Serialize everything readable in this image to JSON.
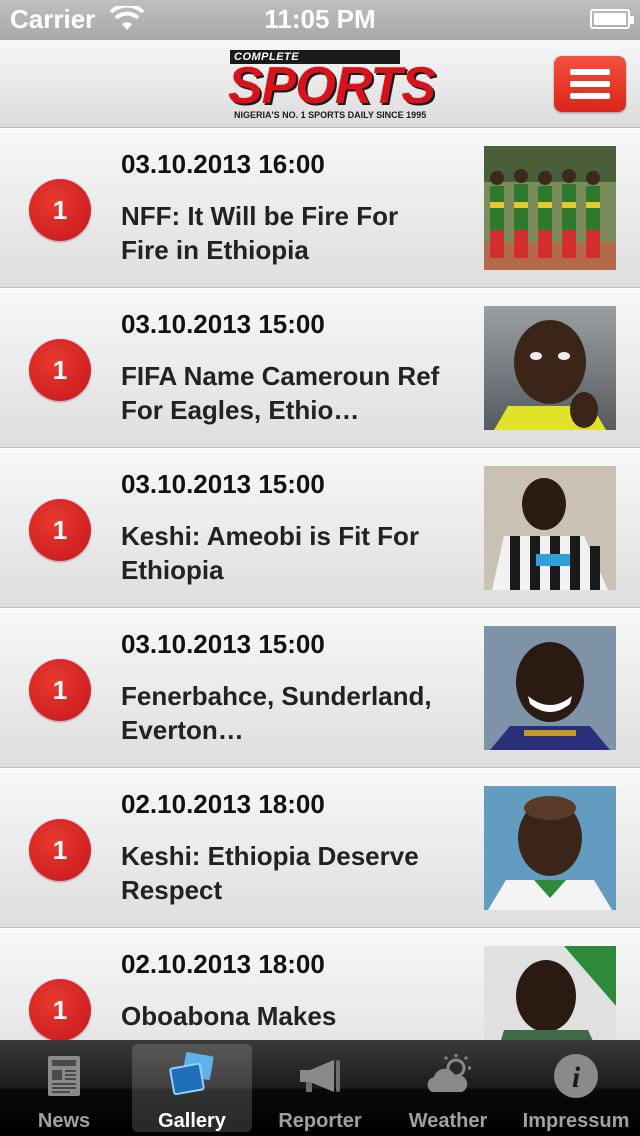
{
  "status_bar": {
    "carrier": "Carrier",
    "time": "11:05 PM"
  },
  "header": {
    "logo_top": "COMPLETE",
    "logo_main": "SPORTS",
    "logo_tagline": "NIGERIA'S NO. 1 SPORTS DAILY SINCE 1995",
    "menu_icon": "hamburger-menu-icon"
  },
  "articles": [
    {
      "badge": "1",
      "date": "03.10.2013 16:00",
      "title": "NFF: It Will be Fire For Fire in Ethiopia"
    },
    {
      "badge": "1",
      "date": "03.10.2013 15:00",
      "title": "FIFA Name Cameroun Ref For Eagles, Ethio…"
    },
    {
      "badge": "1",
      "date": "03.10.2013 15:00",
      "title": "Keshi: Ameobi is Fit For Ethiopia"
    },
    {
      "badge": "1",
      "date": "03.10.2013 15:00",
      "title": "Fenerbahce, Sunderland, Everton…"
    },
    {
      "badge": "1",
      "date": "02.10.2013 18:00",
      "title": "Keshi: Ethiopia Deserve Respect"
    },
    {
      "badge": "1",
      "date": "02.10.2013 18:00",
      "title": "Oboabona Makes"
    }
  ],
  "tabs": [
    {
      "label": "News",
      "icon": "newspaper-icon",
      "selected": false
    },
    {
      "label": "Gallery",
      "icon": "gallery-photos-icon",
      "selected": true
    },
    {
      "label": "Reporter",
      "icon": "megaphone-icon",
      "selected": false
    },
    {
      "label": "Weather",
      "icon": "weather-cloud-sun-icon",
      "selected": false
    },
    {
      "label": "Impressum",
      "icon": "info-icon",
      "selected": false
    }
  ],
  "colors": {
    "accent_red": "#d9261a",
    "badge_red": "#c8161b",
    "logo_red": "#d8121b"
  }
}
